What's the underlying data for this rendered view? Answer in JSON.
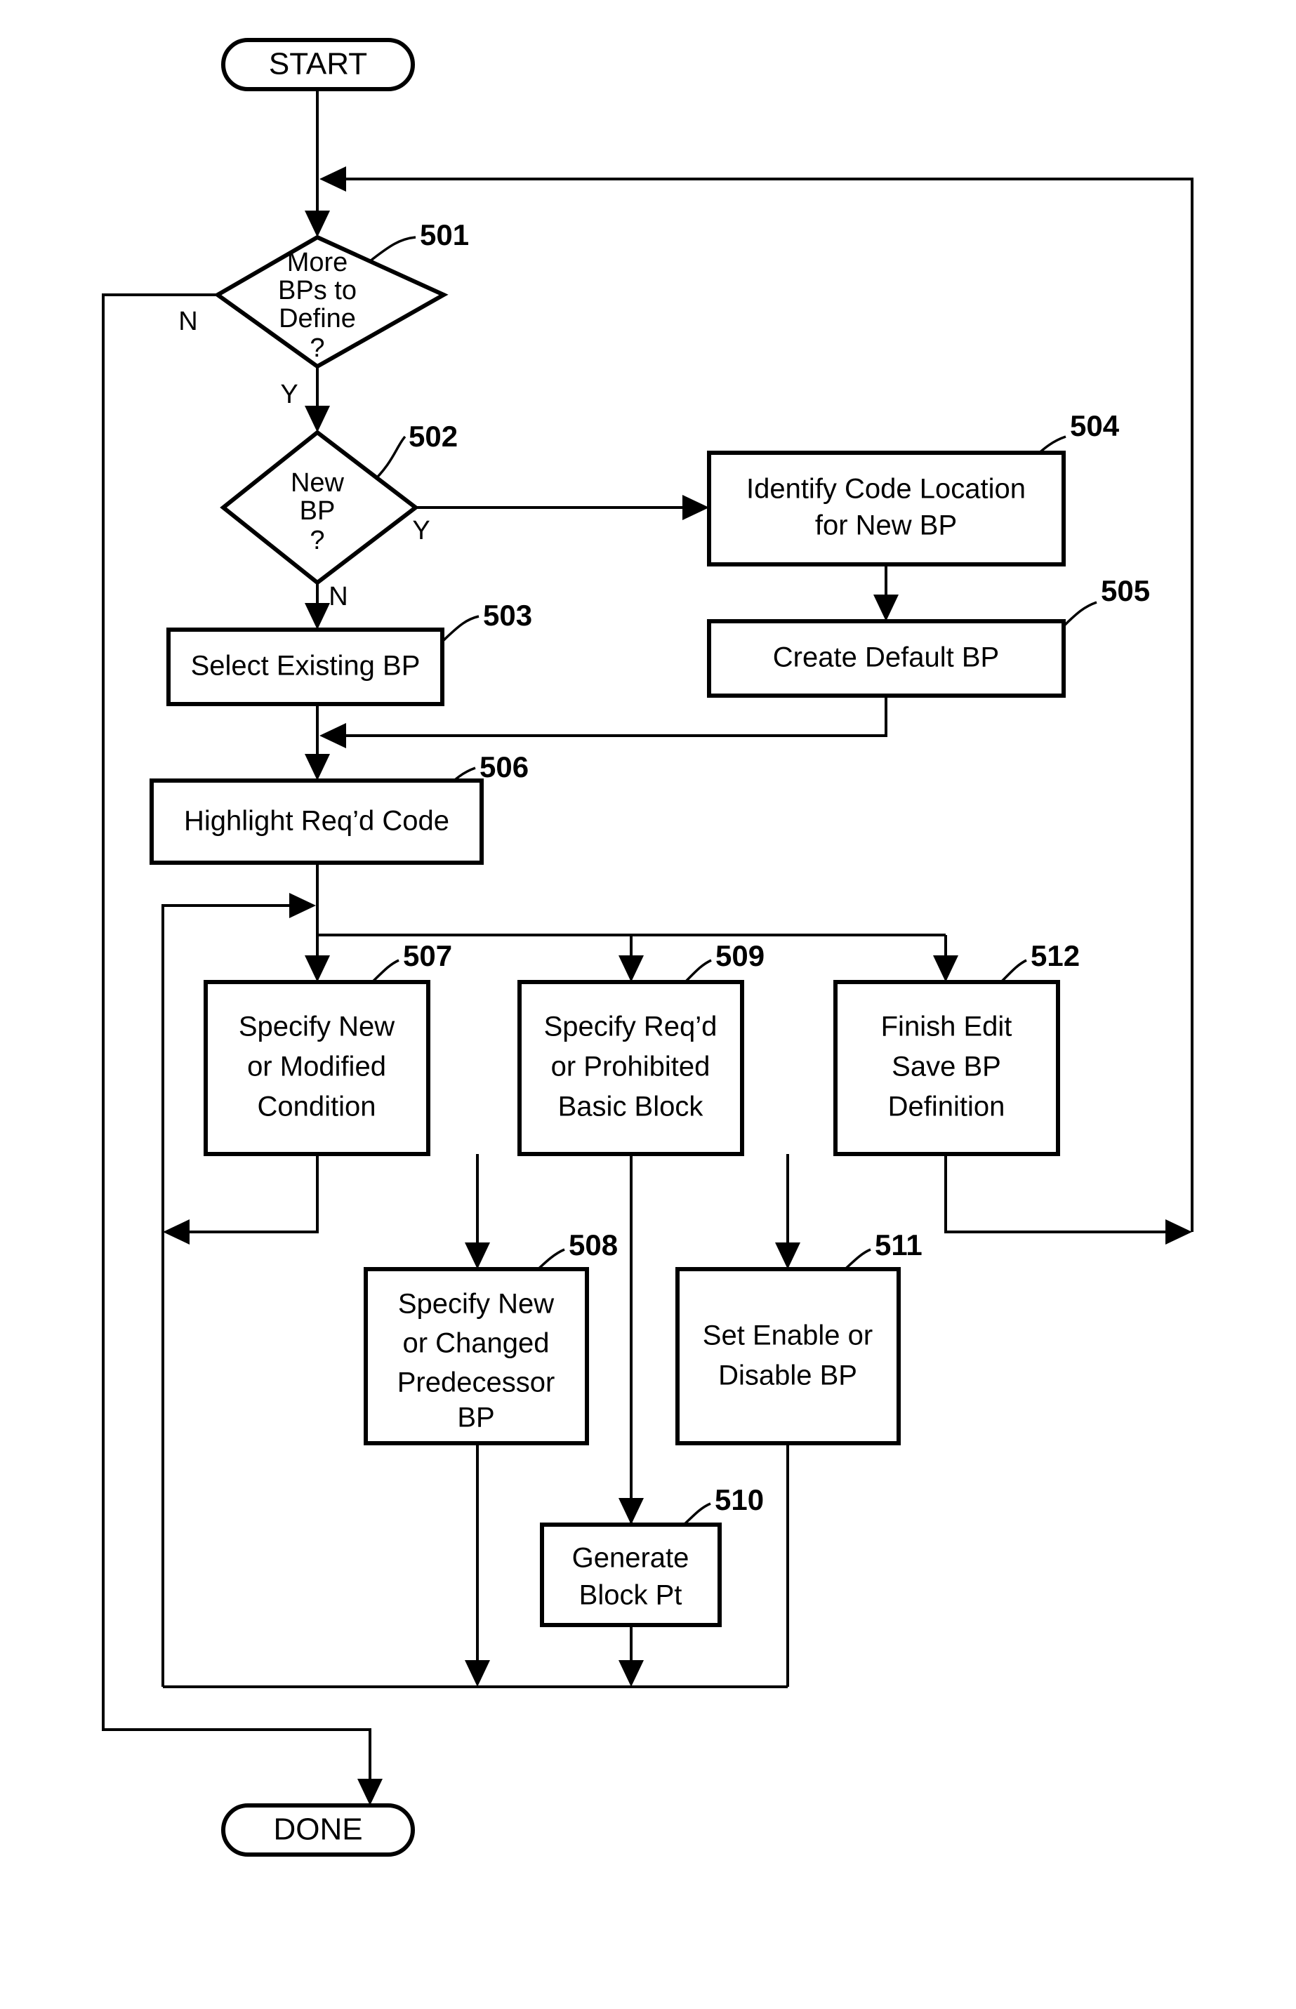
{
  "figure": {
    "type": "flowchart",
    "title": "Breakpoint Definition Flowchart",
    "background_color": "#ffffff",
    "line_color": "#000000"
  },
  "nodes": {
    "start": {
      "ref": "",
      "shape": "terminal",
      "label": "START"
    },
    "done": {
      "ref": "",
      "shape": "terminal",
      "label": "DONE"
    },
    "n501": {
      "ref": "501",
      "shape": "decision",
      "line1": "More",
      "line2": "BPs to",
      "line3": "Define",
      "line4": "?",
      "branch_no": "N",
      "branch_yes": "Y"
    },
    "n502": {
      "ref": "502",
      "shape": "decision",
      "line1": "New",
      "line2": "BP",
      "line3": "?",
      "branch_no": "N",
      "branch_yes": "Y"
    },
    "n503": {
      "ref": "503",
      "shape": "process",
      "line1": "Select Existing BP"
    },
    "n504": {
      "ref": "504",
      "shape": "process",
      "line1": "Identify Code Location",
      "line2": "for New BP"
    },
    "n505": {
      "ref": "505",
      "shape": "process",
      "line1": "Create Default BP"
    },
    "n506": {
      "ref": "506",
      "shape": "process",
      "line1": "Highlight Req’d Code"
    },
    "n507": {
      "ref": "507",
      "shape": "process",
      "line1": "Specify New",
      "line2": "or Modified",
      "line3": "Condition"
    },
    "n508": {
      "ref": "508",
      "shape": "process",
      "line1": "Specify New",
      "line2": "or Changed",
      "line3": "Predecessor",
      "line4": "BP"
    },
    "n509": {
      "ref": "509",
      "shape": "process",
      "line1": "Specify Req’d",
      "line2": "or Prohibited",
      "line3": "Basic Block"
    },
    "n510": {
      "ref": "510",
      "shape": "process",
      "line1": "Generate",
      "line2": "Block Pt"
    },
    "n511": {
      "ref": "511",
      "shape": "process",
      "line1": "Set Enable or",
      "line2": "Disable BP"
    },
    "n512": {
      "ref": "512",
      "shape": "process",
      "line1": "Finish Edit",
      "line2": "Save BP",
      "line3": "Definition"
    }
  }
}
